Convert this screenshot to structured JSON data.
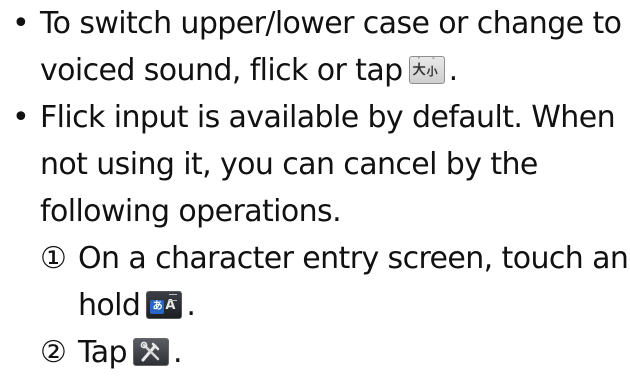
{
  "bullet_symbol": "•",
  "items": [
    {
      "line1": "To switch upper/lower case or change to",
      "line2_before_icon": "voiced sound, flick or tap",
      "line2_after_icon": ".",
      "icon": "upper-lower-case-key-icon"
    },
    {
      "line1": "Flick input is available by default. When",
      "line2": "not using it, you can cancel by the",
      "line3": "following operations."
    }
  ],
  "steps": [
    {
      "marker": "①",
      "line1": "On a character entry screen, touch and",
      "line2_before_icon": "hold",
      "line2_after_icon": ".",
      "icon": "input-mode-key-icon"
    },
    {
      "marker": "②",
      "before_icon": "Tap",
      "after_icon": ".",
      "icon": "settings-tools-key-icon"
    }
  ],
  "icon_glyphs": {
    "case_large": "大",
    "case_small": "小",
    "case_marks": "゛゜",
    "mode_kana": "あ",
    "mode_alpha": "A"
  }
}
